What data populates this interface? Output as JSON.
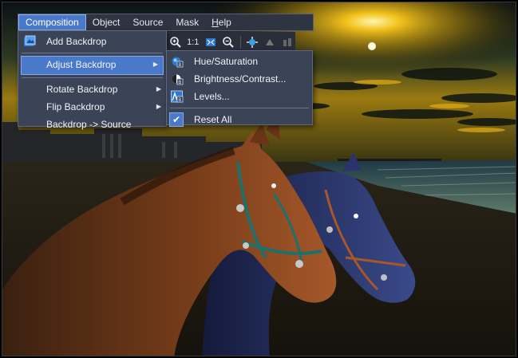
{
  "menubar": {
    "items": [
      {
        "label": "Composition"
      },
      {
        "label": "Object"
      },
      {
        "label": "Source"
      },
      {
        "label": "Mask"
      },
      {
        "label": "Help"
      }
    ]
  },
  "toolbar": {
    "zoom_in_icon": "zoom-in",
    "actual_size_label": "1:1",
    "fit_icon": "fit-window",
    "zoom_out_icon": "zoom-out",
    "move_icon": "move-crosshair"
  },
  "composition_menu": {
    "items": [
      {
        "label": "Add Backdrop",
        "icon": "add-backdrop-icon"
      },
      {
        "label": "Adjust Backdrop",
        "has_submenu": true,
        "highlighted": true
      },
      {
        "label": "Rotate Backdrop",
        "has_submenu": true
      },
      {
        "label": "Flip Backdrop",
        "has_submenu": true
      },
      {
        "label": "Backdrop -> Source"
      }
    ]
  },
  "adjust_submenu": {
    "items": [
      {
        "label": "Hue/Saturation",
        "icon": "hue-saturation-icon"
      },
      {
        "label": "Brightness/Contrast...",
        "icon": "brightness-contrast-icon"
      },
      {
        "label": "Levels...",
        "icon": "levels-icon"
      },
      {
        "label": "Reset All",
        "checked": true
      }
    ]
  },
  "colors": {
    "accent": "#4a79c9",
    "menu_bg": "#3b4356",
    "menubar_bg": "#2f3442"
  }
}
